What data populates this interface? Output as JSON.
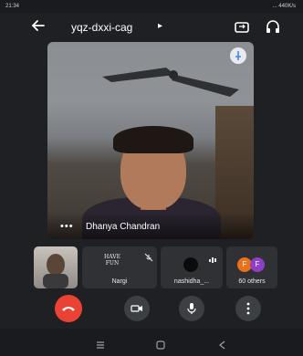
{
  "status_bar": {
    "time": "21:34",
    "right_text": "... 440K/s"
  },
  "header": {
    "meeting_code": "yqz-dxxi-cag"
  },
  "main_video": {
    "speaker_name": "Dhanya Chandran"
  },
  "participants": {
    "nargi": {
      "name": "Nargi",
      "art_line1": "HAVE",
      "art_line2": "FUN"
    },
    "nashidha": {
      "name": "nashidha_..."
    },
    "others": {
      "label": "60 others",
      "avatar1": "F",
      "avatar2": "F"
    }
  },
  "colors": {
    "end_call": "#ea4335",
    "control_bg": "#3c4043",
    "tile_bg": "#303134",
    "background": "#1f2023"
  },
  "icons": [
    "back-arrow-icon",
    "camera-switch-icon",
    "headphones-icon",
    "pin-icon",
    "mic-off-icon",
    "end-call-icon",
    "video-icon",
    "mic-icon",
    "more-icon"
  ]
}
